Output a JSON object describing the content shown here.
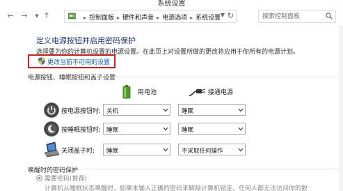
{
  "window": {
    "title": "系统设置"
  },
  "toolbar": {
    "back_icon": "back-arrow-icon",
    "forward_icon": "forward-arrow-icon",
    "recent_icon": "chevron-down-icon",
    "up_icon": "up-arrow-icon",
    "breadcrumb": [
      "控制面板",
      "硬件和声音",
      "电源选项",
      "系统设置"
    ],
    "search_placeholder": "搜索控制面板"
  },
  "main": {
    "title": "定义电源按钮并启用密码保护",
    "description": "选择要为你的计算机设置的电源设置。在此页上对设置所做的更改将应用于你所有的电源计划。",
    "change_link": "更改当前不可用的设置",
    "buttons_section": {
      "title": "电源按钮、睡眠按钮和盖子设置",
      "columns": {
        "battery": "用电池",
        "ac": "接通电源"
      },
      "rows": [
        {
          "label": "按电源按钮时:",
          "icon": "power-button-icon",
          "battery": "关机",
          "ac": "睡眠"
        },
        {
          "label": "按睡眠按钮时:",
          "icon": "sleep-button-icon",
          "battery": "睡眠",
          "ac": "睡眠"
        },
        {
          "label": "关闭盖子时:",
          "icon": "laptop-lid-icon",
          "battery": "睡眠",
          "ac": "不采取任何操作"
        }
      ]
    },
    "password_section": {
      "title": "唤醒时的密码保护",
      "option_label": "需要密码(推荐)",
      "option_desc": "计算机从睡眠状态唤醒时，如果未输入正确的密码来解除计算机锁定，任何人都无法访问你的数"
    }
  },
  "colors": {
    "title_blue": "#1e3287",
    "link_blue": "#0a61b8",
    "highlight_red": "#e01a1a"
  }
}
